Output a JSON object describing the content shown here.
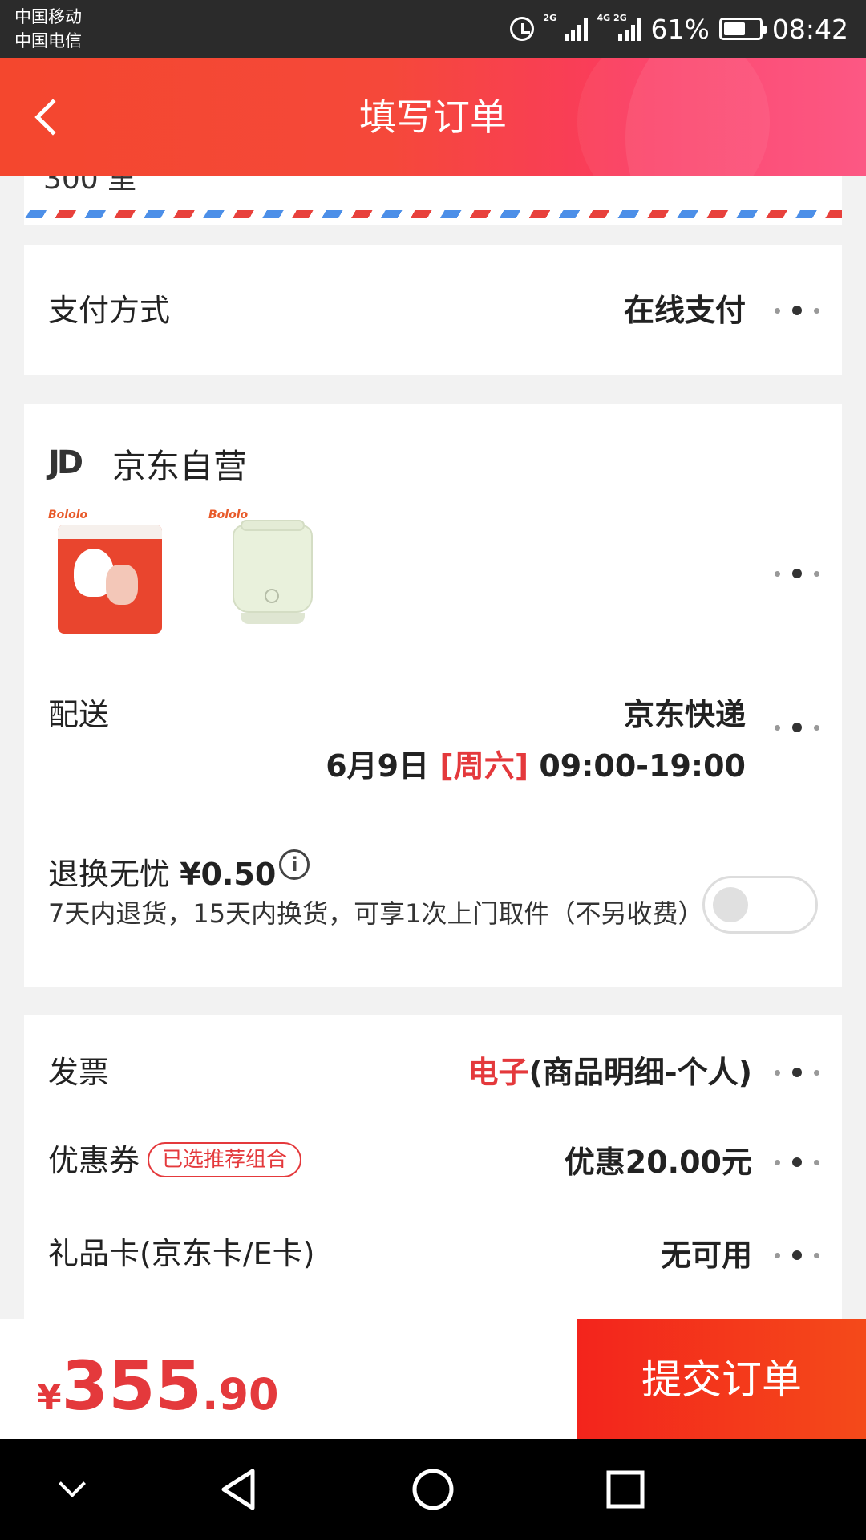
{
  "status_bar": {
    "carrier1": "中国移动",
    "carrier2": "中国电信",
    "net1": "2G",
    "net2": "4G 2G",
    "battery": "61%",
    "time": "08:42",
    "battery_level": 0.61
  },
  "header": {
    "title": "填写订单",
    "back_icon": "back-arrow-icon"
  },
  "address_cut": "300 里",
  "payment": {
    "label": "支付方式",
    "value": "在线支付"
  },
  "shop": {
    "logo": "JD",
    "name": "京东自营",
    "products": [
      {
        "brand": "Bololo",
        "icon": "wet-wipes-pack"
      },
      {
        "brand": "Bololo",
        "icon": "bottle-sterilizer"
      }
    ]
  },
  "delivery": {
    "label": "配送",
    "carrier": "京东快递",
    "date": "6月9日",
    "weekday": "[周六]",
    "time_range": "09:00-19:00"
  },
  "return_insurance": {
    "title": "退换无忧",
    "price": "¥0.50",
    "info_icon": "i",
    "description": "7天内退货，15天内换货，可享1次上门取件（不另收费）",
    "enabled": false
  },
  "invoice": {
    "label": "发票",
    "type": "电子",
    "detail": "(商品明细-个人)"
  },
  "coupon": {
    "label": "优惠券",
    "tag": "已选推荐组合",
    "value": "优惠20.00元"
  },
  "gift_card": {
    "label": "礼品卡(京东卡/E卡)",
    "value": "无可用"
  },
  "bottom": {
    "currency": "¥",
    "total_int": "355",
    "total_dec": ".90",
    "submit_label": "提交订单"
  },
  "colors": {
    "accent": "#e4393c",
    "header_start": "#f4472e",
    "header_end": "#fc4a7a"
  }
}
